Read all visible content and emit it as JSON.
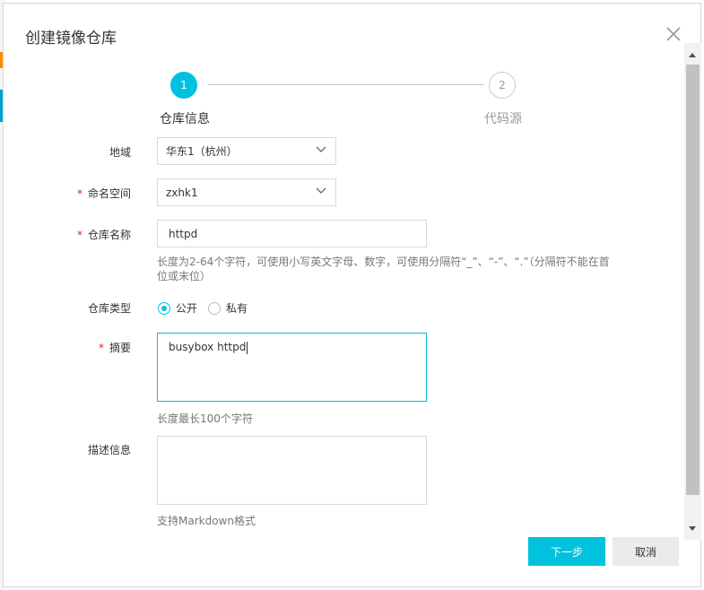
{
  "dialog": {
    "title": "创建镜像仓库"
  },
  "steps": [
    {
      "number": "1",
      "label": "仓库信息",
      "active": true
    },
    {
      "number": "2",
      "label": "代码源",
      "active": false
    }
  ],
  "form": {
    "region": {
      "label": "地域",
      "value": "华东1（杭州）"
    },
    "namespace": {
      "label": "命名空间",
      "value": "zxhk1",
      "required_mark": "*"
    },
    "repo_name": {
      "label": "仓库名称",
      "value": "httpd",
      "required_mark": "*",
      "help_line1": "长度为2-64个字符，可使用小写英文字母、数字，可使用分隔符“_”、“-”、“.”（分隔符不能在首",
      "help_line2": "位或末位）"
    },
    "repo_type": {
      "label": "仓库类型",
      "options": [
        "公开",
        "私有"
      ],
      "selected": "公开"
    },
    "summary": {
      "label": "摘要",
      "value": "busybox httpd",
      "required_mark": "*",
      "help": "长度最长100个字符"
    },
    "description": {
      "label": "描述信息",
      "value": "",
      "help": "支持Markdown格式"
    }
  },
  "buttons": {
    "next": "下一步",
    "cancel": "取消"
  },
  "colors": {
    "accent": "#00c1de",
    "required": "#e1231a"
  }
}
